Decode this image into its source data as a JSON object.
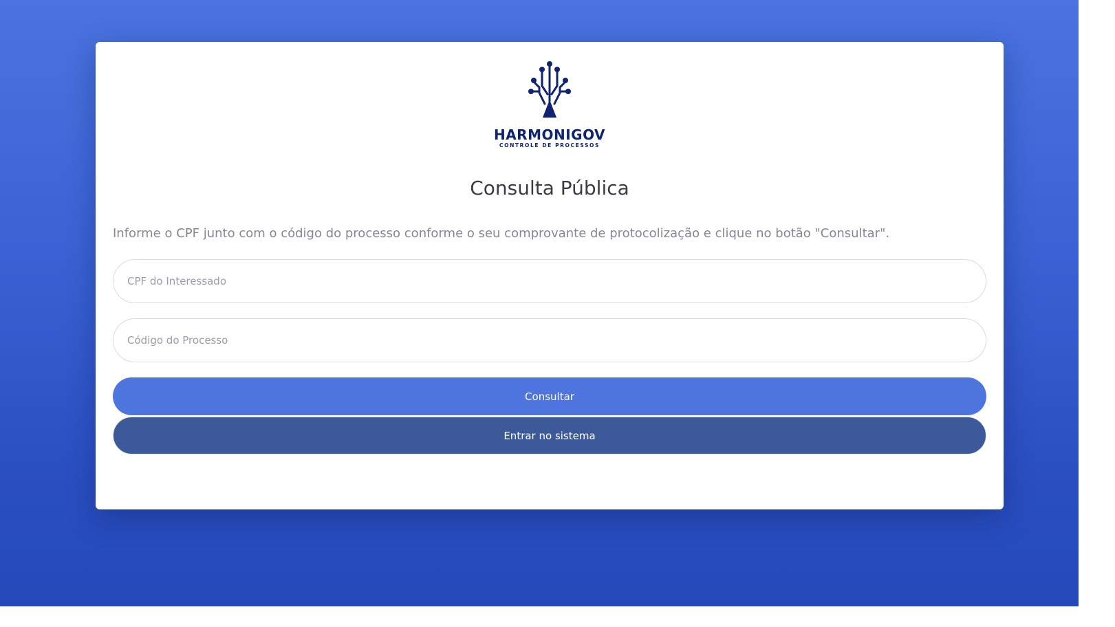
{
  "logo": {
    "icon": "circuit-tree-icon",
    "name": "HARMONIGOV",
    "tagline": "CONTROLE DE PROCESSOS",
    "color": "#0f2370"
  },
  "page": {
    "title": "Consulta Pública",
    "instructions": "Informe o CPF junto com o código do processo conforme o seu comprovante de protocolização e clique no botão \"Consultar\"."
  },
  "form": {
    "cpf_placeholder": "CPF do Interessado",
    "cpf_value": "",
    "codigo_placeholder": "Código do Processo",
    "codigo_value": ""
  },
  "buttons": {
    "consultar_label": "Consultar",
    "entrar_label": "Entrar no sistema"
  },
  "colors": {
    "background_top": "#4a73df",
    "background_bottom": "#2448b8",
    "primary_button": "#4e74de",
    "secondary_button": "#3c5a99"
  }
}
